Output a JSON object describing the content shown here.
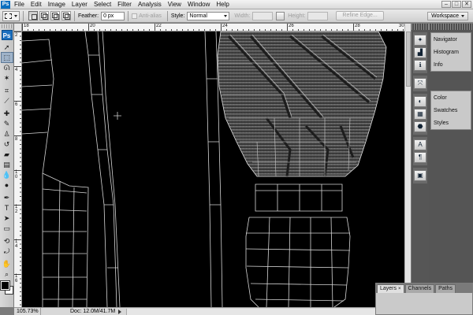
{
  "app": {
    "logo": "Ps"
  },
  "menu": {
    "items": [
      "File",
      "Edit",
      "Image",
      "Layer",
      "Select",
      "Filter",
      "Analysis",
      "View",
      "Window",
      "Help"
    ],
    "window_controls": [
      "–",
      "□",
      "✕"
    ]
  },
  "options": {
    "feather_label": "Feather:",
    "feather_value": "0 px",
    "anti_alias_label": "Anti-alias",
    "style_label": "Style:",
    "style_value": "Normal",
    "width_label": "Width:",
    "height_label": "Height:",
    "refine_edge_label": "Refine Edge...",
    "workspace_label": "Workspace"
  },
  "tools": {
    "items": [
      {
        "name": "move-tool",
        "glyph": "➚"
      },
      {
        "name": "marquee-tool",
        "glyph": "⬚",
        "active": true
      },
      {
        "name": "lasso-tool",
        "glyph": "ᘏ"
      },
      {
        "name": "magic-wand-tool",
        "glyph": "✶"
      },
      {
        "name": "crop-tool",
        "glyph": "⌗"
      },
      {
        "name": "eyedropper-tool",
        "glyph": "⟋"
      },
      {
        "name": "healing-brush-tool",
        "glyph": "✚"
      },
      {
        "name": "brush-tool",
        "glyph": "✎"
      },
      {
        "name": "clone-stamp-tool",
        "glyph": "♙"
      },
      {
        "name": "history-brush-tool",
        "glyph": "↺"
      },
      {
        "name": "eraser-tool",
        "glyph": "▰"
      },
      {
        "name": "gradient-tool",
        "glyph": "▤"
      },
      {
        "name": "blur-tool",
        "glyph": "💧"
      },
      {
        "name": "dodge-tool",
        "glyph": "●"
      },
      {
        "name": "pen-tool",
        "glyph": "✒"
      },
      {
        "name": "type-tool",
        "glyph": "T"
      },
      {
        "name": "path-selection-tool",
        "glyph": "➤"
      },
      {
        "name": "shape-tool",
        "glyph": "▭"
      },
      {
        "name": "3d-rotate-tool",
        "glyph": "⟲"
      },
      {
        "name": "3d-orbit-tool",
        "glyph": "⤾"
      },
      {
        "name": "hand-tool",
        "glyph": "✋"
      },
      {
        "name": "zoom-tool",
        "glyph": "⌕"
      }
    ]
  },
  "ruler": {
    "h_labels": [
      "18",
      "20",
      "22",
      "24",
      "26",
      "28",
      "30"
    ],
    "v_labels": [
      "2",
      "4",
      "6",
      "8",
      "1 0",
      "1 2",
      "1 4",
      "1 6"
    ]
  },
  "status": {
    "zoom": "105.73%",
    "doc": "Doc: 12.0M/41.7M"
  },
  "panels": {
    "group1": [
      {
        "name": "navigator-panel",
        "label": "Navigator",
        "glyph": "✦"
      },
      {
        "name": "histogram-panel",
        "label": "Histogram",
        "glyph": "▟"
      },
      {
        "name": "info-panel",
        "label": "Info",
        "glyph": "ℹ"
      }
    ],
    "group2": [
      {
        "name": "color-panel",
        "label": "Color",
        "glyph": "◐"
      },
      {
        "name": "swatches-panel",
        "label": "Swatches",
        "glyph": "▦"
      },
      {
        "name": "styles-panel",
        "label": "Styles",
        "glyph": "⬣"
      }
    ],
    "group3": [
      {
        "name": "character-panel",
        "glyph": "A"
      },
      {
        "name": "paragraph-panel",
        "glyph": "¶"
      }
    ],
    "group4": [
      {
        "name": "layer-comps-panel",
        "glyph": "▣"
      }
    ]
  },
  "layers_panel": {
    "tabs": [
      "Layers",
      "Channels",
      "Paths"
    ],
    "close_glyph": "×"
  }
}
